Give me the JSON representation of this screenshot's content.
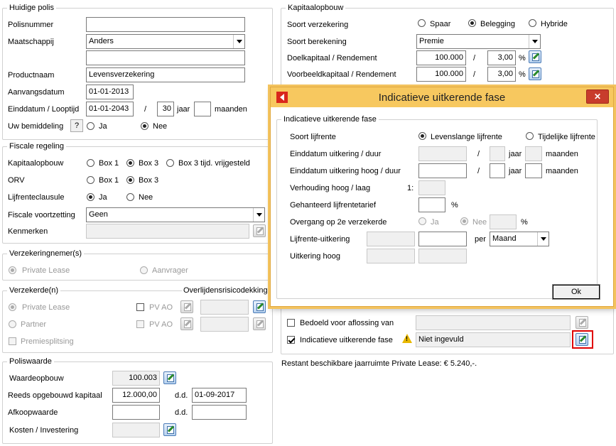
{
  "huidige_polis": {
    "title": "Huidige polis",
    "polisnummer_label": "Polisnummer",
    "polisnummer_value": "",
    "maatschappij_label": "Maatschappij",
    "maatschappij_value": "Anders",
    "maatschappij_extra": "",
    "productnaam_label": "Productnaam",
    "productnaam_value": "Levensverzekering",
    "aanvangsdatum_label": "Aanvangsdatum",
    "aanvangsdatum_value": "01-01-2013",
    "einddatum_label": "Einddatum / Looptijd",
    "einddatum_value": "01-01-2043",
    "slash": "/",
    "looptijd_jaar": "30",
    "jaar_label": "jaar",
    "looptijd_maanden": "",
    "maanden_label": "maanden",
    "bemiddeling_label": "Uw bemiddeling",
    "help_label": "?",
    "ja_label": "Ja",
    "nee_label": "Nee"
  },
  "fiscale_regeling": {
    "title": "Fiscale regeling",
    "kapitaalopbouw_label": "Kapitaalopbouw",
    "box1": "Box 1",
    "box3": "Box 3",
    "box3_vrij": "Box 3 tijd. vrijgesteld",
    "orv_label": "ORV",
    "lijfrente_label": "Lijfrenteclausule",
    "ja": "Ja",
    "nee": "Nee",
    "voortzetting_label": "Fiscale voortzetting",
    "voortzetting_value": "Geen",
    "kenmerken_label": "Kenmerken",
    "kenmerken_value": ""
  },
  "verzekeringnemer": {
    "title": "Verzekeringnemer(s)",
    "private_lease": "Private Lease",
    "aanvrager": "Aanvrager"
  },
  "verzekerde": {
    "title": "Verzekerde(n)",
    "overlijden_title": "Overlijdensrisicodekking",
    "private_lease": "Private Lease",
    "partner": "Partner",
    "pv_ao": "PV AO",
    "premiesplitsing": "Premiesplitsing"
  },
  "poliswaarde": {
    "title": "Poliswaarde",
    "waardeopbouw_label": "Waardeopbouw",
    "waardeopbouw_value": "100.003",
    "reeds_label": "Reeds opgebouwd kapitaal",
    "reeds_value": "12.000,00",
    "dd_label": "d.d.",
    "reeds_date": "01-09-2017",
    "afkoop_label": "Afkoopwaarde",
    "afkoop_value": "",
    "afkoop_date": "",
    "kosten_label": "Kosten / Investering",
    "kosten_value": ""
  },
  "kapitaalopbouw": {
    "title": "Kapitaalopbouw",
    "soort_label": "Soort verzekering",
    "spaar": "Spaar",
    "belegging": "Belegging",
    "hybride": "Hybride",
    "berekening_label": "Soort berekening",
    "berekening_value": "Premie",
    "doel_label": "Doelkapitaal / Rendement",
    "doel_value": "100.000",
    "doel_rend": "3,00",
    "voorbeeld_label": "Voorbeeldkapitaal / Rendement",
    "voorbeeld_value": "100.000",
    "voorbeeld_rend": "3,00",
    "slash": "/",
    "pct": "%",
    "bedoeld_label": "Bedoeld voor aflossing van",
    "bedoeld_value": "",
    "indicatief_label": "Indicatieve uitkerende fase",
    "indicatief_value": "Niet ingevuld",
    "restant_text": "Restant beschikbare jaarruimte Private Lease: € 5.240,-."
  },
  "dialog": {
    "title": "Indicatieve uitkerende fase",
    "close": "✕",
    "group_title": "Indicatieve uitkerende fase",
    "soort_label": "Soort lijfrente",
    "levenslang": "Levenslange lijfrente",
    "tijdelijk": "Tijdelijke lijfrente",
    "einddatum_label": "Einddatum uitkering / duur",
    "einddatum_hoog_label": "Einddatum uitkering hoog / duur",
    "slash": "/",
    "jaar": "jaar",
    "maanden": "maanden",
    "verhouding_label": "Verhouding hoog / laag",
    "verhouding_prefix": "1:",
    "gegarandeerd_label": "Gehanteerd lijfrentetarief",
    "pct": "%",
    "overgang_label": "Overgang op 2e verzekerde",
    "ja": "Ja",
    "nee": "Nee",
    "uitkering_label": "Lijfrente-uitkering",
    "per_label": "per",
    "per_value": "Maand",
    "hoog_label": "Uitkering hoog",
    "ok_label": "Ok"
  },
  "colors": {
    "dialog_title_bg": "#f7c85f",
    "dialog_border": "#e0a840",
    "highlight_red": "#e00000",
    "close_red": "#c83c2c"
  }
}
